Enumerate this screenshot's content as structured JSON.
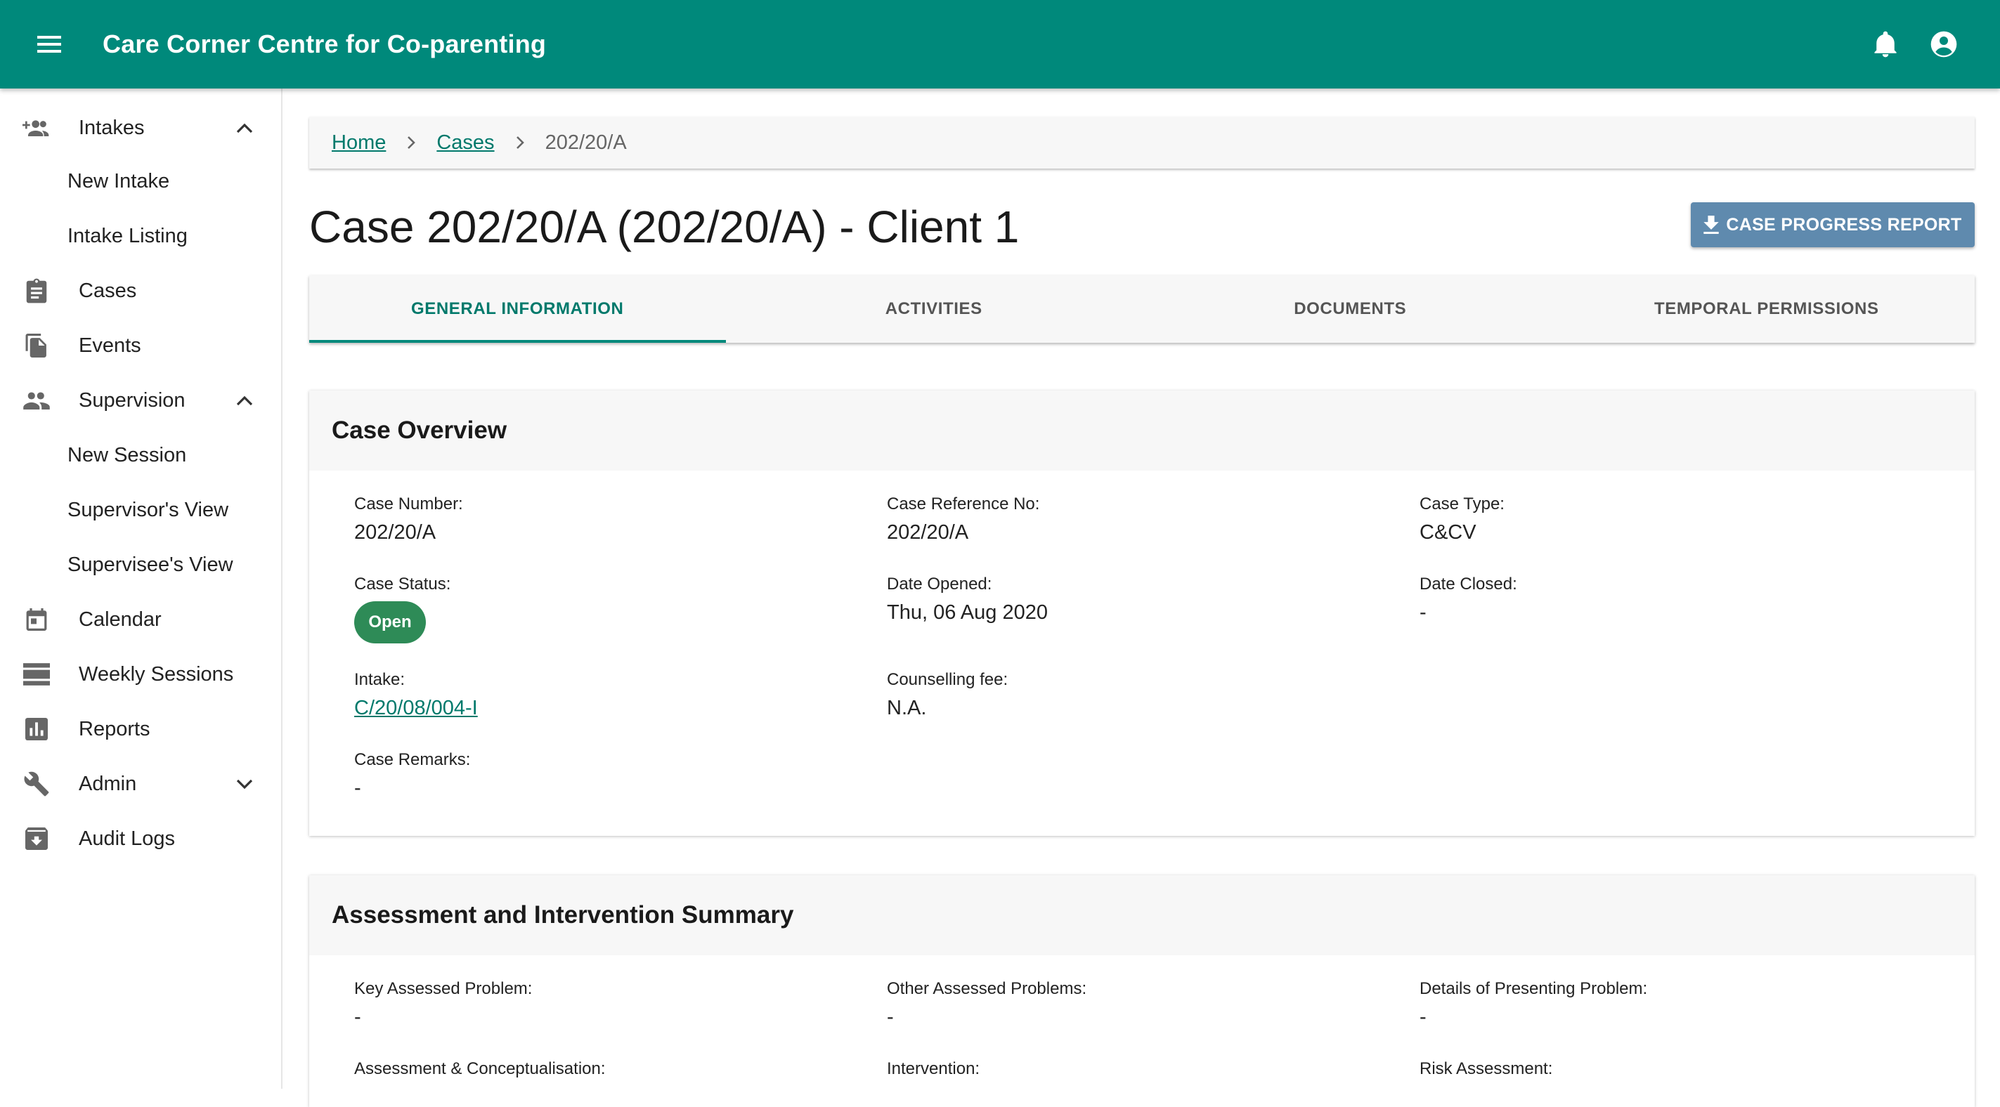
{
  "appbar": {
    "title": "Care Corner Centre for Co-parenting",
    "menu_icon": "menu-icon",
    "notifications_icon": "bell-icon",
    "account_icon": "account-circle-icon",
    "color": "#00897b"
  },
  "sidebar": {
    "items": [
      {
        "label": "Intakes",
        "icon": "person-add-icon",
        "expanded": true
      },
      {
        "label": "New Intake"
      },
      {
        "label": "Intake Listing"
      },
      {
        "label": "Cases",
        "icon": "clipboard-icon"
      },
      {
        "label": "Events",
        "icon": "file-copy-icon"
      },
      {
        "label": "Supervision",
        "icon": "people-icon",
        "expanded": true
      },
      {
        "label": "New Session"
      },
      {
        "label": "Supervisor's View"
      },
      {
        "label": "Supervisee's View"
      },
      {
        "label": "Calendar",
        "icon": "calendar-icon"
      },
      {
        "label": "Weekly Sessions",
        "icon": "view-list-icon"
      },
      {
        "label": "Reports",
        "icon": "bar-chart-icon"
      },
      {
        "label": "Admin",
        "icon": "wrench-icon",
        "expanded": false
      },
      {
        "label": "Audit Logs",
        "icon": "archive-icon"
      }
    ]
  },
  "breadcrumb": {
    "home": "Home",
    "cases": "Cases",
    "current": "202/20/A"
  },
  "page": {
    "title": "Case 202/20/A (202/20/A) - Client 1",
    "report_button": "CASE PROGRESS REPORT",
    "button_color": "#5f8aae"
  },
  "tabs": [
    {
      "label": "GENERAL INFORMATION",
      "active": true
    },
    {
      "label": "ACTIVITIES"
    },
    {
      "label": "DOCUMENTS"
    },
    {
      "label": "TEMPORAL PERMISSIONS"
    }
  ],
  "case_overview": {
    "heading": "Case Overview",
    "case_number": {
      "label": "Case Number:",
      "value": "202/20/A"
    },
    "case_reference": {
      "label": "Case Reference No:",
      "value": "202/20/A"
    },
    "case_type": {
      "label": "Case Type:",
      "value": "C&CV"
    },
    "case_status": {
      "label": "Case Status:",
      "value": "Open",
      "color": "#2e8b57"
    },
    "date_opened": {
      "label": "Date Opened:",
      "value": "Thu, 06 Aug 2020"
    },
    "date_closed": {
      "label": "Date Closed:",
      "value": "-"
    },
    "intake": {
      "label": "Intake:",
      "value": "C/20/08/004-I"
    },
    "counselling_fee": {
      "label": "Counselling fee:",
      "value": "N.A."
    },
    "case_remarks": {
      "label": "Case Remarks:",
      "value": "-"
    }
  },
  "assessment": {
    "heading": "Assessment and Intervention Summary",
    "key_problem": {
      "label": "Key Assessed Problem:",
      "value": "-"
    },
    "other_problems": {
      "label": "Other Assessed Problems:",
      "value": "-"
    },
    "presenting_problem": {
      "label": "Details of Presenting Problem:",
      "value": "-"
    },
    "conceptualisation": {
      "label": "Assessment & Conceptualisation:"
    },
    "intervention": {
      "label": "Intervention:"
    },
    "risk_assessment": {
      "label": "Risk Assessment:"
    }
  }
}
